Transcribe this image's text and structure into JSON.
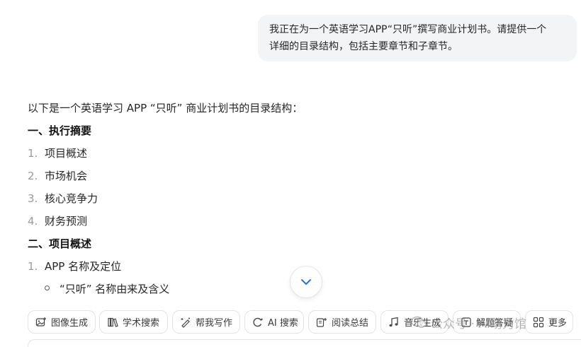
{
  "user_message": {
    "line1": "我正在为一个英语学习APP“只听”撰写商业计划书。请提供一个",
    "line2": "详细的目录结构，包括主要章节和子章节。"
  },
  "answer": {
    "intro": "以下是一个英语学习 APP “只听” 商业计划书的目录结构：",
    "sections": [
      {
        "title": "一、执行摘要",
        "items": [
          {
            "num": "1.",
            "text": "项目概述"
          },
          {
            "num": "2.",
            "text": "市场机会"
          },
          {
            "num": "3.",
            "text": "核心竞争力"
          },
          {
            "num": "4.",
            "text": "财务预测"
          }
        ]
      },
      {
        "title": "二、项目概述",
        "items": [
          {
            "num": "1.",
            "text": "APP 名称及定位"
          }
        ],
        "sub_items": [
          "“只听” 名称由来及含义"
        ]
      }
    ]
  },
  "toolbar": {
    "chips": [
      {
        "label": "图像生成",
        "icon": "image-gen-icon"
      },
      {
        "label": "学术搜索",
        "icon": "academic-search-icon"
      },
      {
        "label": "帮我写作",
        "icon": "writing-icon"
      },
      {
        "label": "AI 搜索",
        "icon": "ai-search-icon"
      },
      {
        "label": "阅读总结",
        "icon": "reading-summary-icon"
      },
      {
        "label": "音乐生成",
        "icon": "music-note-icon"
      },
      {
        "label": "解题答疑",
        "icon": "problem-solving-icon"
      },
      {
        "label": "更多",
        "icon": "more-grid-icon"
      }
    ]
  },
  "watermark": "公众号 · AI助力馆",
  "colors": {
    "bubble_bg": "#f3f4f6",
    "accent_blue": "#2f6fe0",
    "muted_number": "#9a9a9a"
  }
}
